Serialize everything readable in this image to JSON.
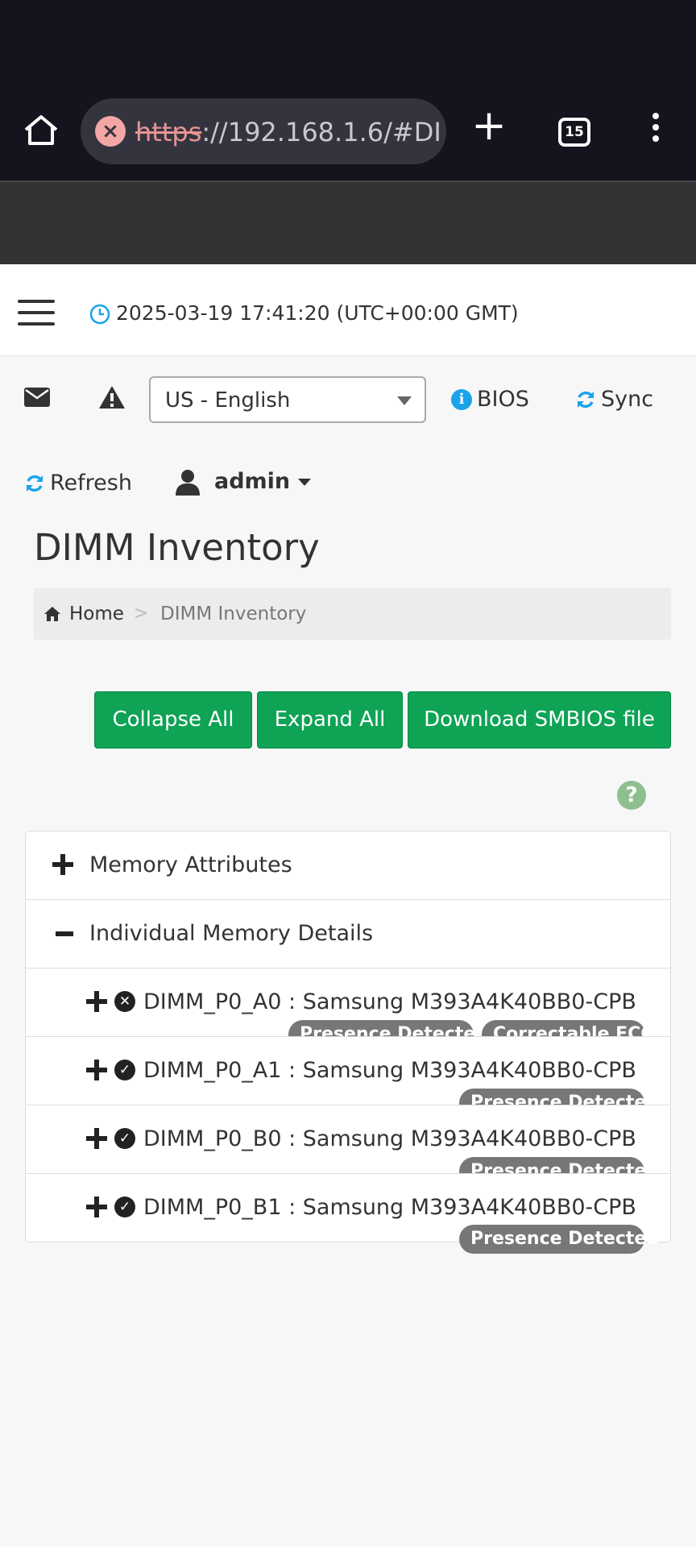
{
  "browser": {
    "url_scheme": "https",
    "url_rest": "://192.168.1.6/#DI",
    "tab_count": "15"
  },
  "header": {
    "datetime": "2025-03-19 17:41:20 (UTC+00:00 GMT)"
  },
  "toolbar": {
    "language": "US - English",
    "bios_label": "BIOS",
    "sync_label": "Sync",
    "refresh_label": "Refresh",
    "user_label": "admin"
  },
  "page": {
    "title": "DIMM Inventory",
    "breadcrumb": {
      "home": "Home",
      "separator": ">",
      "current": "DIMM Inventory"
    }
  },
  "actions": {
    "collapse_all": "Collapse All",
    "expand_all": "Expand All",
    "download_smbios": "Download SMBIOS file",
    "help_glyph": "?"
  },
  "accordion": {
    "sections": [
      {
        "label": "Memory Attributes",
        "state": "collapsed"
      },
      {
        "label": "Individual Memory Details",
        "state": "expanded"
      }
    ],
    "dimms": [
      {
        "label": "DIMM_P0_A0 : Samsung M393A4K40BB0-CPB",
        "status": "error",
        "badges": [
          "Presence Detected",
          "Correctable ECC"
        ]
      },
      {
        "label": "DIMM_P0_A1 : Samsung M393A4K40BB0-CPB",
        "status": "ok",
        "badges": [
          "Presence Detected"
        ]
      },
      {
        "label": "DIMM_P0_B0 : Samsung M393A4K40BB0-CPB",
        "status": "ok",
        "badges": [
          "Presence Detected"
        ]
      },
      {
        "label": "DIMM_P0_B1 : Samsung M393A4K40BB0-CPB",
        "status": "ok",
        "badges": [
          "Presence Detected"
        ]
      }
    ]
  },
  "colors": {
    "button_green": "#0ea355",
    "badge_gray": "#777777",
    "info_blue": "#1aa3ea",
    "browser_dark": "#14141e"
  },
  "icons": [
    "home-icon",
    "insecure-icon",
    "new-tab-icon",
    "tab-switcher-icon",
    "menu-kebab-icon",
    "hamburger-icon",
    "clock-icon",
    "mail-icon",
    "warning-icon",
    "info-icon",
    "sync-icon",
    "refresh-icon",
    "user-icon",
    "help-icon",
    "plus-icon",
    "minus-icon",
    "error-circle-icon",
    "check-circle-icon"
  ]
}
